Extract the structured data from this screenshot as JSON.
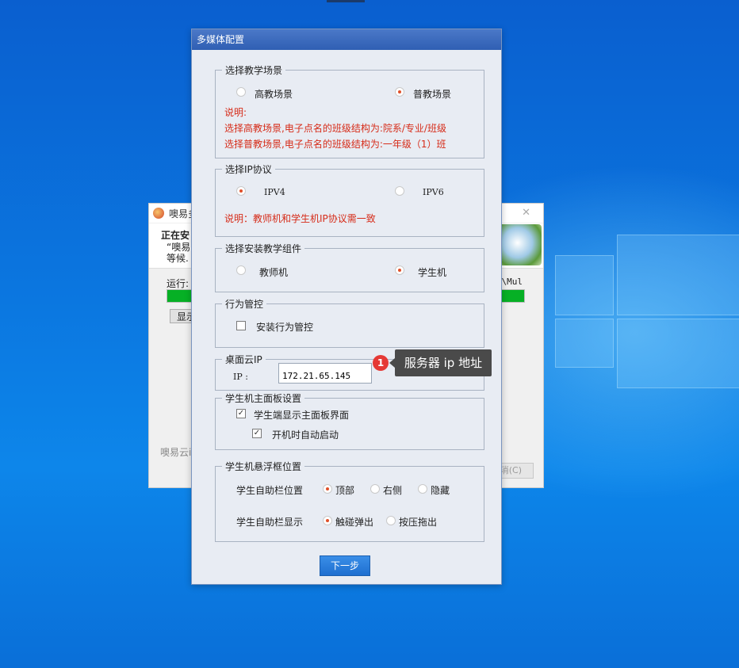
{
  "colors": {
    "accent": "#2f5fb3",
    "note_red": "#d62b18",
    "radio_on": "#e0502a",
    "progress": "#06b025"
  },
  "background_window": {
    "title": "噢易多",
    "heading": "正在安",
    "line1": "“噢易",
    "line2": "等候.",
    "run_label": "运行:",
    "path_tail": "n\\Mul",
    "show_button": "显示",
    "brand": "噢易云i",
    "cancel_button": "消(C)",
    "progress_fraction": 1.0
  },
  "dialog": {
    "title": "多媒体配置",
    "scene": {
      "legend": "选择教学场景",
      "options": [
        "高教场景",
        "普教场景"
      ],
      "selected": "普教场景",
      "note_title": "说明:",
      "note_line1": "选择高教场景,电子点名的班级结构为:院系/专业/班级",
      "note_line2": "选择普教场景,电子点名的班级结构为:一年级（1）班"
    },
    "ip_protocol": {
      "legend": "选择IP协议",
      "options": [
        "IPV4",
        "IPV6"
      ],
      "selected": "IPV4",
      "note": "说明：教师机和学生机IP协议需一致"
    },
    "component": {
      "legend": "选择安装教学组件",
      "options": [
        "教师机",
        "学生机"
      ],
      "selected": "学生机"
    },
    "behavior": {
      "legend": "行为管控",
      "checkbox_label": "安装行为管控",
      "checked": false
    },
    "cloud_ip": {
      "legend": "桌面云IP",
      "label": "IP :",
      "value": "172.21.65.145"
    },
    "panel": {
      "legend": "学生机主面板设置",
      "option1": "学生端显示主面板界面",
      "option2": "开机时自动启动",
      "option1_checked": true,
      "option2_checked": true
    },
    "float": {
      "legend": "学生机悬浮框位置",
      "pos_label": "学生自助栏位置",
      "pos_options": [
        "顶部",
        "右侧",
        "隐藏"
      ],
      "pos_selected": "顶部",
      "show_label": "学生自助栏显示",
      "show_options": [
        "触碰弹出",
        "按压拖出"
      ],
      "show_selected": "触碰弹出"
    },
    "next_button": "下一步"
  },
  "annotation": {
    "badge": "1",
    "text": "服务器 ip 地址"
  }
}
